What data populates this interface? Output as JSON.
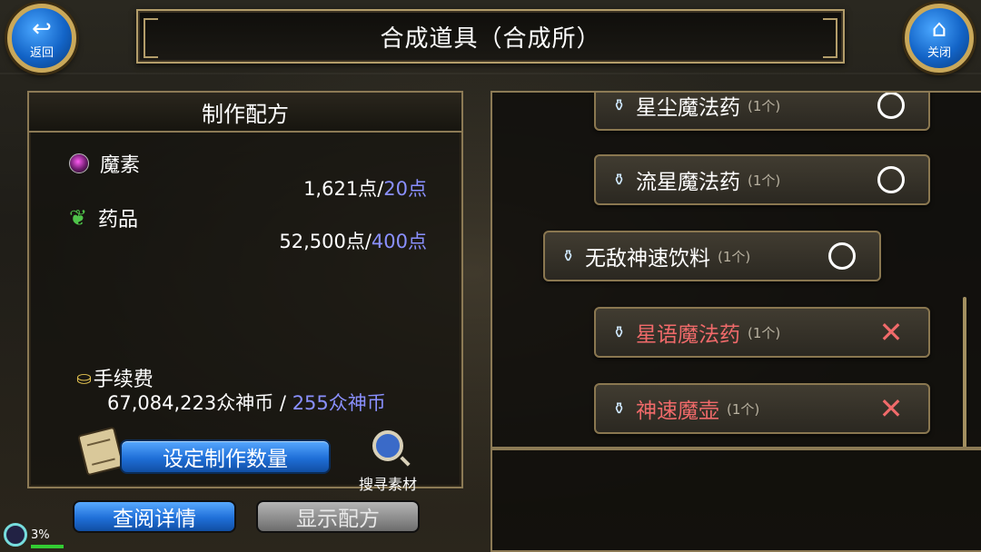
{
  "window": {
    "title": "合成道具（合成所）"
  },
  "nav": {
    "back_label": "返回",
    "close_label": "关闭"
  },
  "recipe": {
    "header": "制作配方",
    "materials": [
      {
        "name": "魔素",
        "have": "1,621点",
        "separator": "/",
        "need": "20点",
        "icon": "dark-orb-icon"
      },
      {
        "name": "药品",
        "have": "52,500点",
        "separator": "/",
        "need": "400点",
        "icon": "herb-icon"
      }
    ],
    "fee": {
      "label": "手续费",
      "have": "67,084,223众神币",
      "separator": " / ",
      "need": "255众神币"
    },
    "set_quantity_label": "设定制作数量",
    "search_label": "搜寻素材"
  },
  "buttons": {
    "view_details": "查阅详情",
    "show_recipe": "显示配方"
  },
  "status": {
    "percent": "3%"
  },
  "items": [
    {
      "name": "星尘魔法药",
      "count": "(1个)",
      "status": "available"
    },
    {
      "name": "流星魔法药",
      "count": "(1个)",
      "status": "available"
    },
    {
      "name": "无敌神速饮料",
      "count": "(1个)",
      "status": "available"
    },
    {
      "name": "星语魔法药",
      "count": "(1个)",
      "status": "unavailable"
    },
    {
      "name": "神速魔壶",
      "count": "(1个)",
      "status": "unavailable"
    }
  ],
  "colors": {
    "required": "#8a90ff",
    "unavailable": "#f06a6a",
    "frame": "#8c7a55",
    "button_blue": "#1f6fd8"
  }
}
